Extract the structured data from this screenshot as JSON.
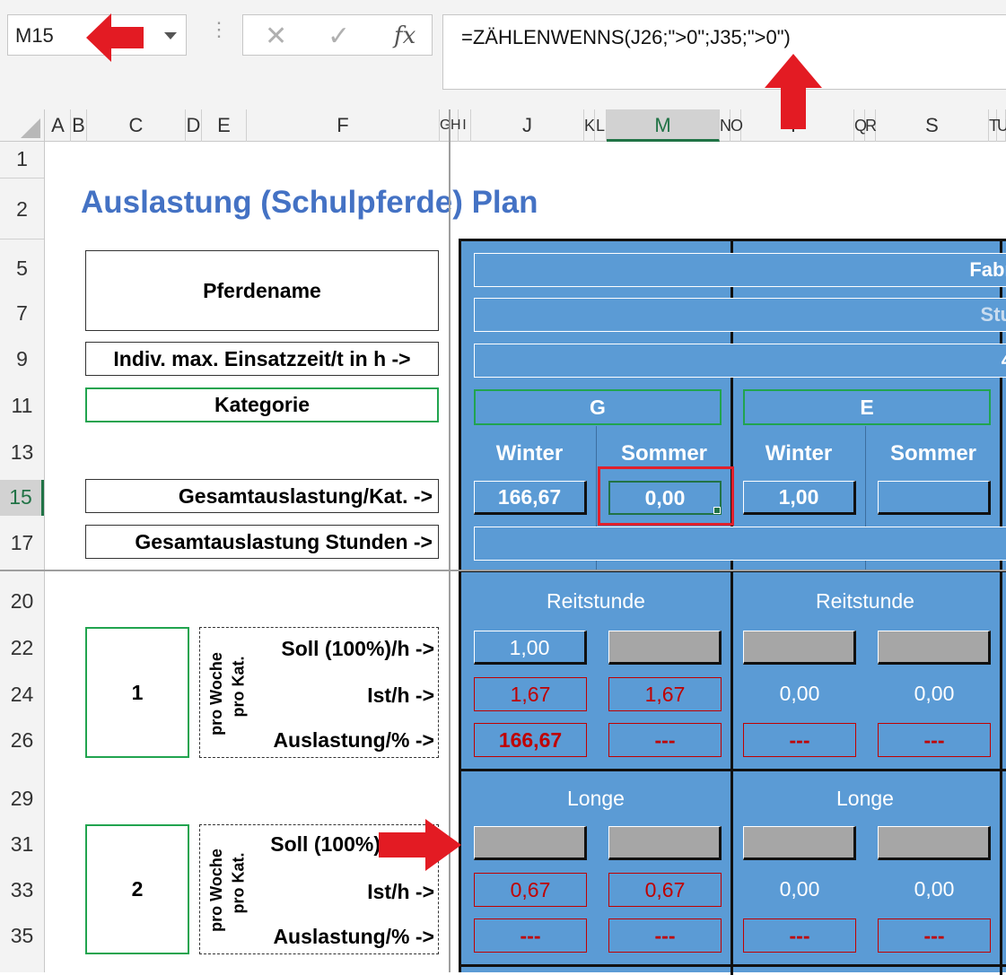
{
  "formula_bar": {
    "name_box": "M15",
    "cancel": "✕",
    "enter": "✓",
    "fx": "fx",
    "formula": "=ZÄHLENWENNS(J26;\">0\";J35;\">0\")"
  },
  "columns": [
    "A",
    "B",
    "C",
    "D",
    "E",
    "F",
    "G",
    "H",
    "I",
    "J",
    "K",
    "L",
    "M",
    "N",
    "O",
    "P",
    "Q",
    "R",
    "S",
    "T",
    "U"
  ],
  "rows": [
    "1",
    "2",
    "5",
    "7",
    "9",
    "11",
    "13",
    "15",
    "17",
    "20",
    "22",
    "24",
    "26",
    "29",
    "31",
    "33",
    "35"
  ],
  "sheet": {
    "title": "Auslastung (Schulpferde) Plan",
    "pferdename": "Pferdename",
    "einsatzzeit": "Indiv. max. Einsatzzeit/t in h ->",
    "kategorie": "Kategorie",
    "gesamt_kat": "Gesamtauslastung/Kat. ->",
    "gesamt_std": "Gesamtauslastung Stunden ->",
    "header_bars": [
      "Fabr",
      "Stu",
      "4"
    ],
    "categories": [
      "G",
      "E"
    ],
    "seasons": [
      "Winter",
      "Sommer",
      "Winter",
      "Sommer"
    ],
    "totals": [
      "166,67",
      "0,00",
      "1,00",
      ""
    ],
    "group1": {
      "number": "1",
      "pro_woche": "pro Woche",
      "pro_kat": "pro Kat.",
      "soll": "Soll (100%)/h ->",
      "ist": "Ist/h ->",
      "auslastung": "Auslastung/% ->",
      "section": [
        "Reitstunde",
        "Reitstunde"
      ],
      "soll_vals": [
        "1,00",
        "",
        "",
        ""
      ],
      "ist_vals": [
        "1,67",
        "1,67",
        "0,00",
        "0,00"
      ],
      "ausl_vals": [
        "166,67",
        "---",
        "---",
        "---"
      ]
    },
    "group2": {
      "number": "2",
      "pro_woche": "pro Woche",
      "pro_kat": "pro Kat.",
      "soll": "Soll (100%)",
      "ist": "Ist/h ->",
      "auslastung": "Auslastung/% ->",
      "section": [
        "Longe",
        "Longe"
      ],
      "ist_vals": [
        "0,67",
        "0,67",
        "0,00",
        "0,00"
      ],
      "ausl_vals": [
        "---",
        "---",
        "---",
        "---"
      ]
    }
  },
  "colors": {
    "accent_blue": "#4472c4",
    "cell_blue": "#5b9bd5",
    "excel_green": "#217346",
    "red": "#e31b23"
  }
}
